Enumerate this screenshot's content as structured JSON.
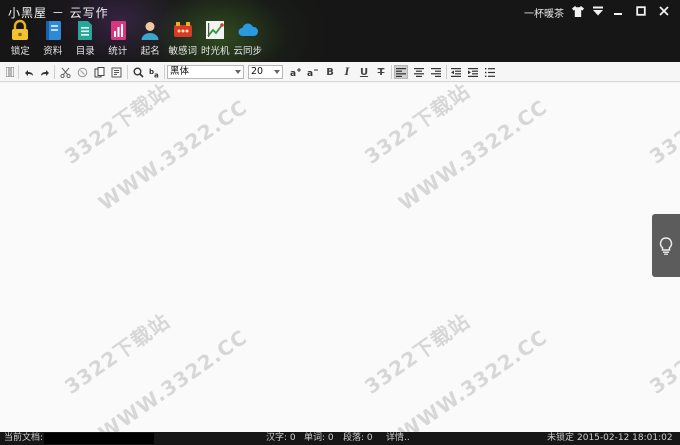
{
  "window": {
    "title": "小黑屋 － 云写作",
    "brand": "一杯暖茶"
  },
  "tools": [
    {
      "label": "锁定",
      "icon": "lock-icon",
      "color": "#e8b321"
    },
    {
      "label": "资料",
      "icon": "book-icon",
      "color": "#2f88d8"
    },
    {
      "label": "目录",
      "icon": "list-icon",
      "color": "#2aa59a"
    },
    {
      "label": "统计",
      "icon": "stats-icon",
      "color": "#d8367f"
    },
    {
      "label": "起名",
      "icon": "person-icon",
      "color": "#3aa6c9"
    },
    {
      "label": "敏感词",
      "icon": "sensitive-words-icon",
      "color": "#d83a2a"
    },
    {
      "label": "时光机",
      "icon": "time-machine-icon",
      "color": "#e9e9e9"
    },
    {
      "label": "云同步",
      "icon": "cloud-icon",
      "color": "#2a9ae0"
    }
  ],
  "toolbar": {
    "font_family": "黑体",
    "font_size": "20",
    "bold": "B",
    "italic": "I",
    "underline": "U",
    "strike": "T"
  },
  "watermark": "3322下载站",
  "watermark_site": "WWW.3322.CC",
  "status": {
    "current_doc_label": "当前文档:",
    "chars": "汉字: 0",
    "words": "单词: 0",
    "paragraphs": "段落: 0",
    "details": "详情..",
    "lock_state": "未锁定",
    "datetime": "2015-02-12 18:01:02"
  }
}
